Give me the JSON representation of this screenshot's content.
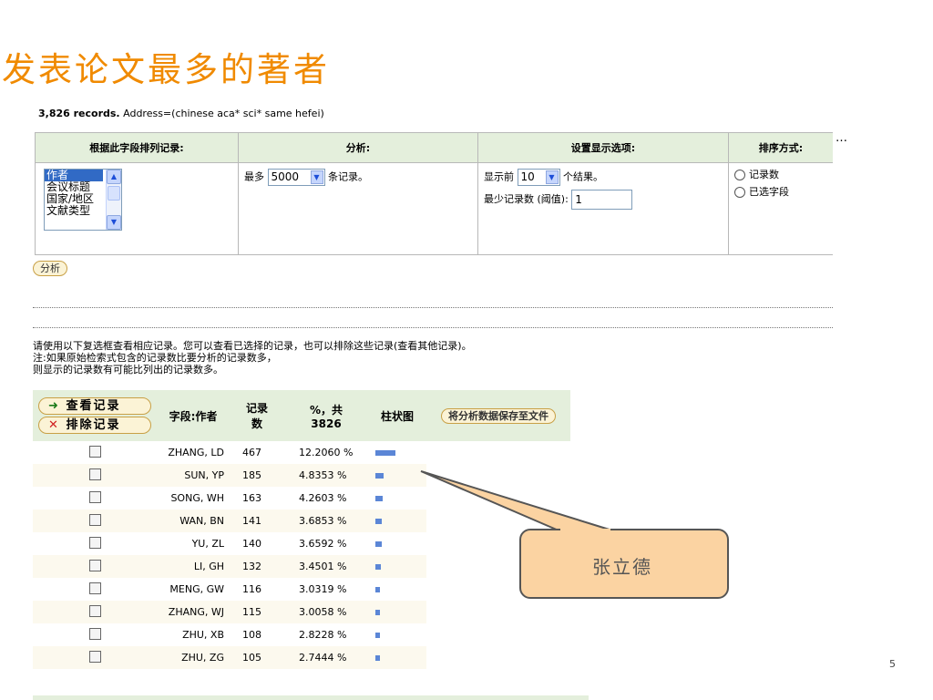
{
  "title": "发表论文最多的著者",
  "records_count": "3,826 records.",
  "records_query": "Address=(chinese aca* sci* same hefei)",
  "options": {
    "col1_header": "根据此字段排列记录:",
    "col2_header": "分析:",
    "col3_header": "设置显示选项:",
    "col4_header": "排序方式:",
    "more": "…",
    "fields": [
      "作者",
      "会议标题",
      "国家/地区",
      "文献类型"
    ],
    "max_prefix": "最多",
    "max_value": "5000",
    "max_suffix": "条记录。",
    "show_prefix": "显示前",
    "show_value": "10",
    "show_suffix": "个结果。",
    "min_label": "最少记录数 (阈值):",
    "min_value": "1",
    "sort_option1": "记录数",
    "sort_option2": "已选字段"
  },
  "analyze_button": "分析",
  "instructions": [
    "请使用以下复选框查看相应记录。您可以查看已选择的记录，也可以排除这些记录(查看其他记录)。",
    "注:如果原始检索式包含的记录数比要分析的记录数多，",
    "则显示的记录数有可能比列出的记录数多。"
  ],
  "results": {
    "view_button": "查看记录",
    "exclude_button": "排除记录",
    "view_icon": "arrow-right-icon",
    "exclude_icon": "x-icon",
    "col_field": "字段:作者",
    "col_count_line1": "记录",
    "col_count_line2": "数",
    "col_pct_line1": "%，共",
    "col_pct_line2": "3826",
    "col_bar": "柱状图",
    "save_button": "将分析数据保存至文件",
    "bar_color": "#5b86d6",
    "rows": [
      {
        "name": "ZHANG, LD",
        "count": "467",
        "pct": "12.2060 %",
        "share": 0.12206
      },
      {
        "name": "SUN, YP",
        "count": "185",
        "pct": "4.8353 %",
        "share": 0.048353
      },
      {
        "name": "SONG, WH",
        "count": "163",
        "pct": "4.2603 %",
        "share": 0.042603
      },
      {
        "name": "WAN, BN",
        "count": "141",
        "pct": "3.6853 %",
        "share": 0.036853
      },
      {
        "name": "YU, ZL",
        "count": "140",
        "pct": "3.6592 %",
        "share": 0.036592
      },
      {
        "name": "LI, GH",
        "count": "132",
        "pct": "3.4501 %",
        "share": 0.034501
      },
      {
        "name": "MENG, GW",
        "count": "116",
        "pct": "3.0319 %",
        "share": 0.030319
      },
      {
        "name": "ZHANG, WJ",
        "count": "115",
        "pct": "3.0058 %",
        "share": 0.030058
      },
      {
        "name": "ZHU, XB",
        "count": "108",
        "pct": "2.8228 %",
        "share": 0.028228
      },
      {
        "name": "ZHU, ZG",
        "count": "105",
        "pct": "2.7444 %",
        "share": 0.027444
      }
    ]
  },
  "callout_text": "张立德",
  "page_number": "5"
}
